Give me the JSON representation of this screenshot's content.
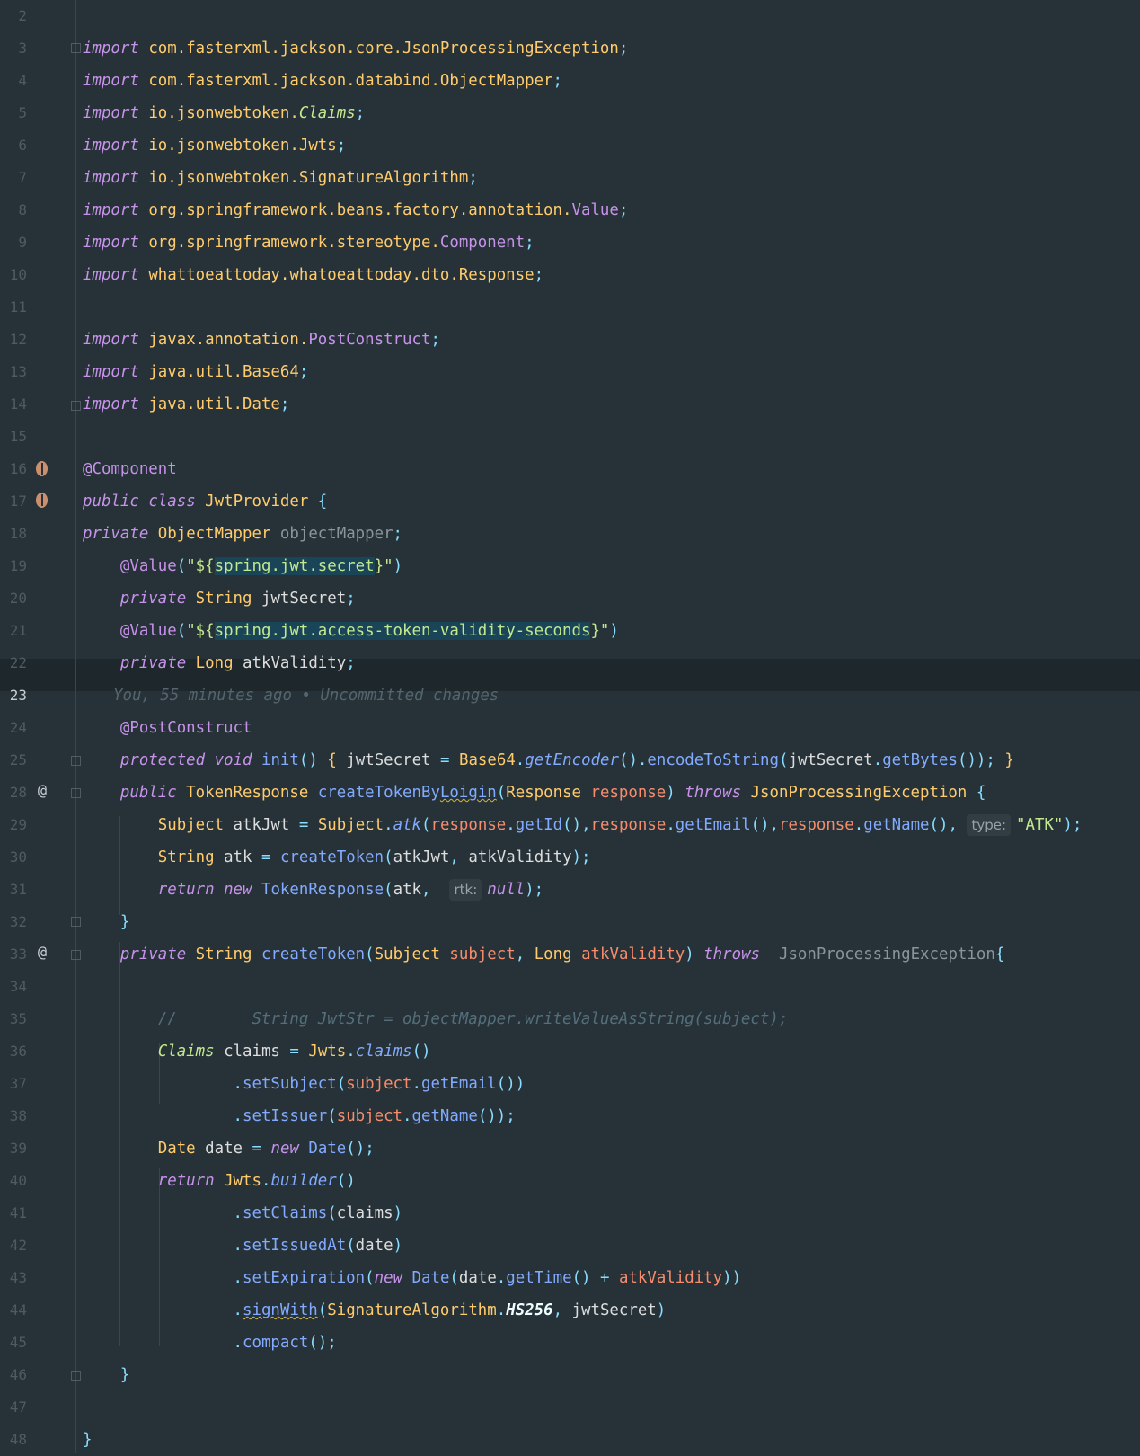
{
  "editor": {
    "line_numbers": [
      "2",
      "3",
      "4",
      "5",
      "6",
      "7",
      "8",
      "9",
      "10",
      "11",
      "12",
      "13",
      "14",
      "15",
      "16",
      "17",
      "18",
      "19",
      "20",
      "21",
      "22",
      "23",
      "24",
      "25",
      "28",
      "29",
      "30",
      "31",
      "32",
      "33",
      "34",
      "35",
      "36",
      "37",
      "38",
      "39",
      "40",
      "41",
      "42",
      "43",
      "44",
      "45",
      "46",
      "47",
      "48"
    ],
    "current_line": "23",
    "blame_annotation": "You, 55 minutes ago • Uncommitted changes",
    "comment_line": "//        String JwtStr = objectMapper.writeValueAsString(subject);",
    "imports": [
      {
        "pkg": "com.fasterxml.jackson.core.",
        "cls": "JsonProcessingException"
      },
      {
        "pkg": "com.fasterxml.jackson.databind.",
        "cls": "ObjectMapper"
      },
      {
        "pkg": "io.jsonwebtoken.",
        "cls": "Claims"
      },
      {
        "pkg": "io.jsonwebtoken.",
        "cls": "Jwts"
      },
      {
        "pkg": "io.jsonwebtoken.",
        "cls": "SignatureAlgorithm"
      },
      {
        "pkg": "org.springframework.beans.factory.annotation.",
        "cls": "Value"
      },
      {
        "pkg": "org.springframework.stereotype.",
        "cls": "Component"
      },
      {
        "pkg": "whattoeattoday.whatoeattoday.dto.",
        "cls": "Response"
      },
      {
        "pkg": "javax.annotation.",
        "cls": "PostConstruct"
      },
      {
        "pkg": "java.util.",
        "cls": "Base64"
      },
      {
        "pkg": "java.util.",
        "cls": "Date"
      }
    ],
    "tokens": {
      "import_kw": "import",
      "semicolon": ";",
      "component_ann": "@Component",
      "public_kw": "public",
      "class_kw": "class",
      "class_name": "JwtProvider",
      "open_brace": " {",
      "private_kw": "private",
      "object_mapper_type": "ObjectMapper",
      "object_mapper_field": "objectMapper",
      "value_ann": "@Value",
      "secret_prop": "spring.jwt.secret",
      "validity_prop": "spring.jwt.access-token-validity-seconds",
      "string_type": "String",
      "jwt_secret": "jwtSecret",
      "long_type": "Long",
      "atk_validity": "atkValidity",
      "post_construct_ann": "@PostConstruct",
      "protected_kw": "protected",
      "void_kw": "void",
      "init_fn": "init",
      "base64": "Base64",
      "get_encoder": "getEncoder",
      "encode_to_string": "encodeToString",
      "get_bytes": "getBytes",
      "token_response": "TokenResponse",
      "create_token_by_loigin_a": "createTokenBy",
      "create_token_by_loigin_b": "Loigin",
      "response_type": "Response",
      "response_param": "response",
      "throws_kw": "throws",
      "json_exc": "JsonProcessingException",
      "subject_type": "Subject",
      "atk_jwt": "atkJwt",
      "atk_fn": "atk",
      "get_id": "getId",
      "get_email": "getEmail",
      "get_name": "getName",
      "hint_type": "type:",
      "atk_str": "\"ATK\"",
      "atk_var": "atk",
      "create_token_fn": "createToken",
      "return_kw": "return",
      "new_kw": "new",
      "hint_rtk": "rtk:",
      "null_kw": "null",
      "subject_param": "subject",
      "claims_type": "Claims",
      "claims_var": "claims",
      "jwts": "Jwts",
      "claims_fn": "claims",
      "set_subject": "setSubject",
      "set_issuer": "setIssuer",
      "date_type": "Date",
      "date_var": "date",
      "builder_fn": "builder",
      "set_claims": "setClaims",
      "set_issued_at": "setIssuedAt",
      "set_expiration": "setExpiration",
      "get_time": "getTime",
      "sign_with": "signWith",
      "signature_algorithm": "SignatureAlgorithm",
      "hs256": "HS256",
      "compact": "compact",
      "at_icon_symbol": "@"
    }
  },
  "colors": {
    "background": "#263238",
    "keyword": "#c792ea",
    "class_name": "#ffcb6b",
    "function": "#82aaff",
    "parameter": "#f78c6c",
    "string": "#c3e88d",
    "comment": "#546e7a"
  }
}
